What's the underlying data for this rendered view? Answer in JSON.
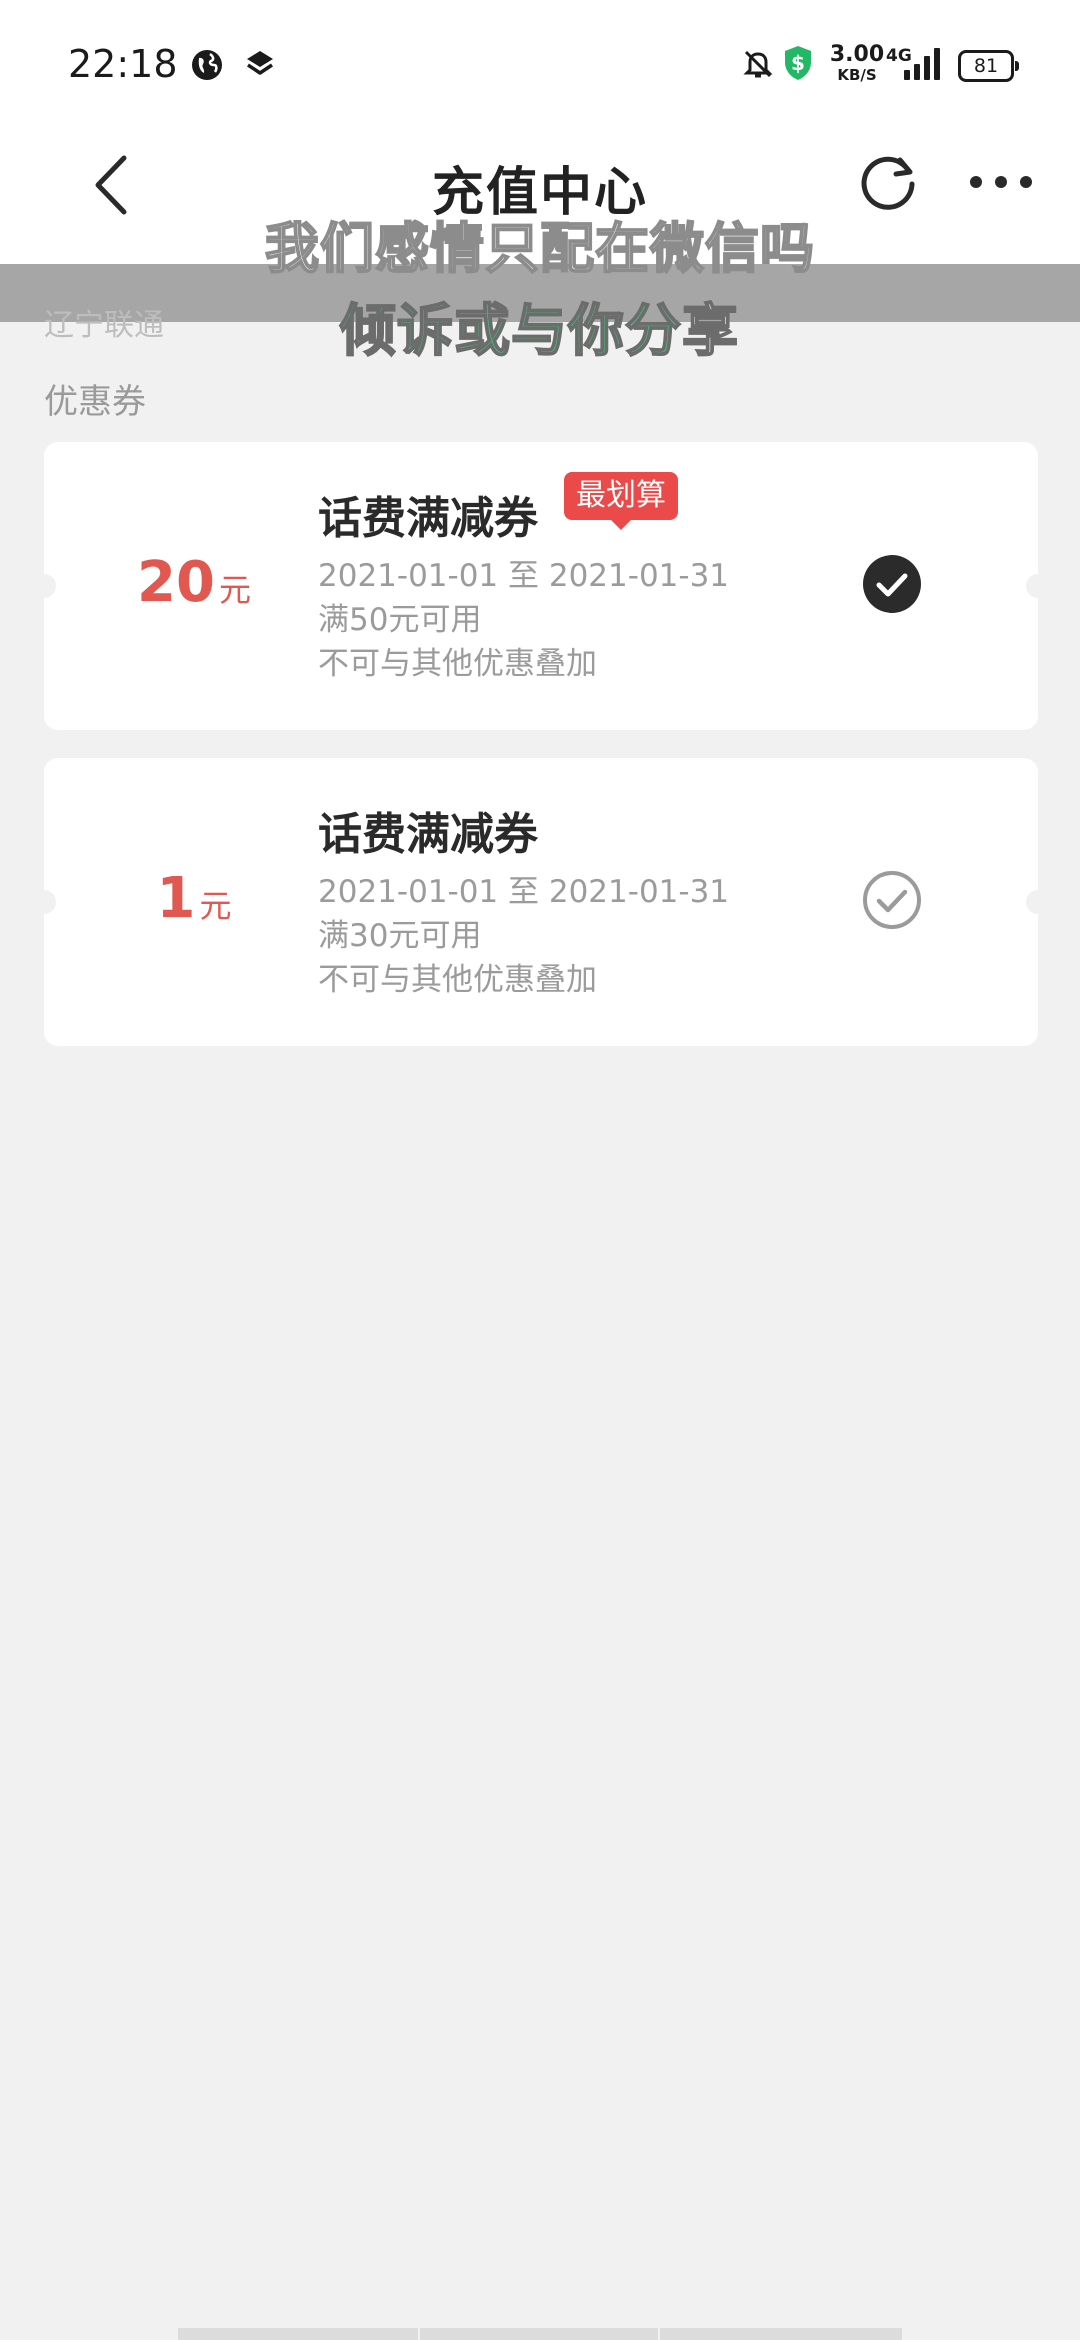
{
  "status_bar": {
    "time": "22:18",
    "net_speed_value": "3.00",
    "net_speed_unit": "KB/S",
    "network": "4G",
    "battery": "81"
  },
  "header": {
    "title": "充值中心"
  },
  "overlay": {
    "band_text": "辽宁联通",
    "lyric_line1": "我们感情只配在微信吗",
    "lyric_line2_green": "倾诉或与你分",
    "lyric_line2_white": "享"
  },
  "section": {
    "label": "优惠券"
  },
  "coupons": [
    {
      "amount": "20",
      "unit": "元",
      "title": "话费满减券",
      "tag": "最划算",
      "validity": "2021-01-01 至 2021-01-31",
      "threshold": "满50元可用",
      "note": "不可与其他优惠叠加",
      "selected": true
    },
    {
      "amount": "1",
      "unit": "元",
      "title": "话费满减券",
      "validity": "2021-01-01 至 2021-01-31",
      "threshold": "满30元可用",
      "note": "不可与其他优惠叠加",
      "selected": false
    }
  ],
  "colors": {
    "accent_red": "#e0584f",
    "tag_red": "#ea4a4a",
    "background": "#f1f1f1"
  },
  "icons": {
    "back": "chevron-left-icon",
    "refresh": "refresh-icon",
    "more": "more-horizontal-icon",
    "checked": "check-circle-filled-icon",
    "unchecked": "check-circle-outline-icon"
  }
}
